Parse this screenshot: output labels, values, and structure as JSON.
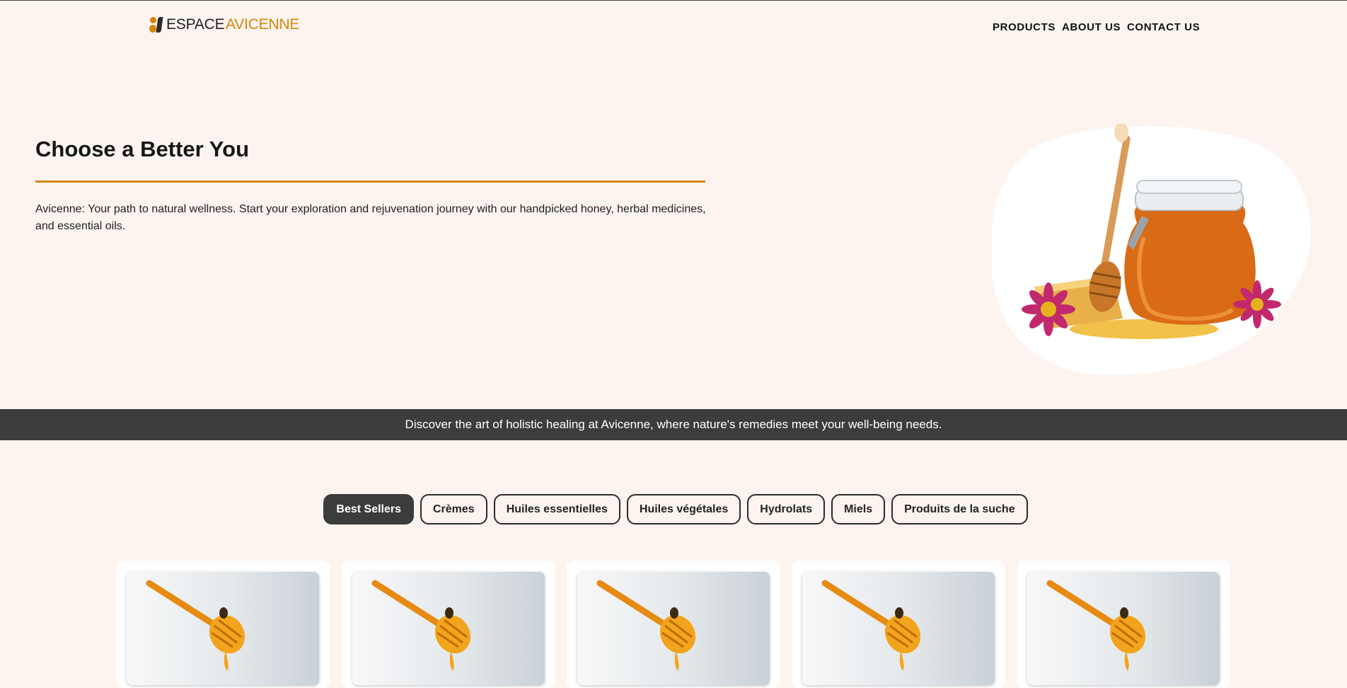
{
  "brand": {
    "word1": "ESPACE",
    "word2": "AVICENNE"
  },
  "nav": {
    "products": "PRODUCTS",
    "about": "ABOUT US",
    "contact": "CONTACT US"
  },
  "hero": {
    "title": "Choose a Better You",
    "text": "Avicenne: Your path to natural wellness. Start your exploration and rejuvenation journey with our handpicked honey, herbal medicines, and essential oils."
  },
  "banner": {
    "text": "Discover the art of holistic healing at Avicenne, where nature's remedies meet your well-being needs."
  },
  "tabs": [
    {
      "label": "Best Sellers",
      "active": true
    },
    {
      "label": "Crèmes"
    },
    {
      "label": "Huiles essentielles"
    },
    {
      "label": "Huiles végétales"
    },
    {
      "label": "Hydrolats"
    },
    {
      "label": "Miels"
    },
    {
      "label": "Produits de la suche"
    }
  ],
  "colors": {
    "accent": "#d4860b",
    "background": "#fdf4f0",
    "banner": "#3c3c3c"
  },
  "icons": {
    "hero_image": "honey-jar-with-dipper-image",
    "card_image": "honey-dipper-image"
  }
}
